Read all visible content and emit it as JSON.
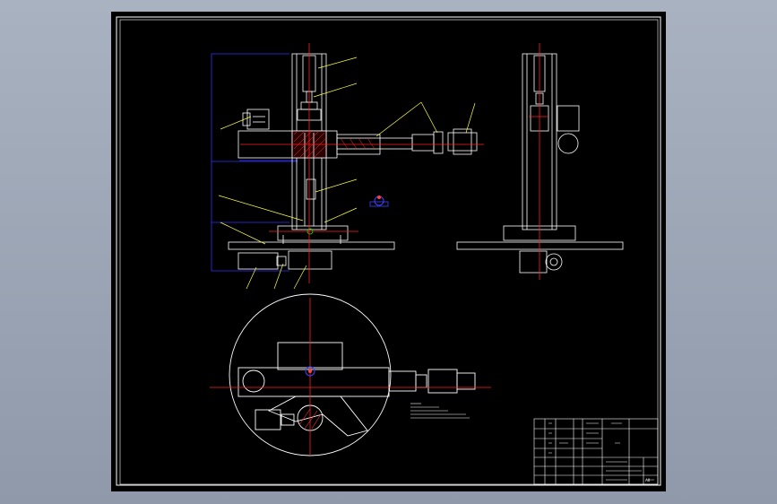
{
  "viewport": {
    "background": "#9ca5b4",
    "paper": "#000000"
  },
  "colors": {
    "frame": "#ffffff",
    "outline": "#ffffff",
    "centerline": "#ff0000",
    "dimension": "#0000ff",
    "leader": "#ffff00",
    "hatch": "#ff0000",
    "marker": "#00ff00",
    "symbol_blue": "#4040ff"
  },
  "views": [
    "front-view",
    "side-view",
    "top-view"
  ],
  "title_block": {
    "scale": "A0"
  }
}
